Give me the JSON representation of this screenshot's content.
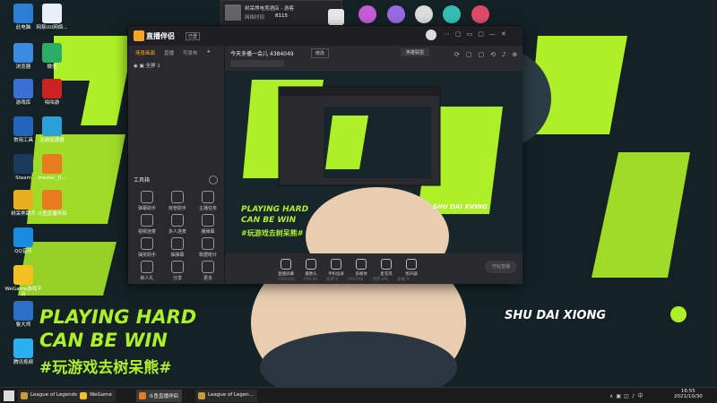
{
  "desktop": {
    "icons": [
      {
        "label": "此电脑",
        "icon": "computer-icon",
        "color": "#2a7fd4"
      },
      {
        "label": "网易UU网络...",
        "icon": "uu-icon",
        "color": "#e8eef5"
      },
      {
        "label": "浏览器",
        "icon": "browser-icon",
        "color": "#3b8be0"
      },
      {
        "label": "微信",
        "icon": "wechat-icon",
        "color": "#2aae67"
      },
      {
        "label": "游戏库",
        "icon": "gamelib-icon",
        "color": "#3b6fd8"
      },
      {
        "label": "咕咕游",
        "icon": "game-icon",
        "color": "#c22"
      },
      {
        "label": "常用工具",
        "icon": "x-icon",
        "color": "#2266bb"
      },
      {
        "label": "迅游加速器",
        "icon": "booster-icon",
        "color": "#2a9fd8"
      },
      {
        "label": "Steam",
        "icon": "steam-icon",
        "color": "#1b3a5c"
      },
      {
        "label": "master_D...",
        "icon": "master-icon",
        "color": "#e87b1f"
      },
      {
        "label": "树呆熊助手",
        "icon": "bear-icon",
        "color": "#e8b020"
      },
      {
        "label": "斗鱼直播伴侣",
        "icon": "douyu-icon",
        "color": "#e87b1f"
      },
      {
        "label": "QQ音乐",
        "icon": "qq-icon",
        "color": "#1a8ce0"
      },
      {
        "label": "WeGame游戏平台",
        "icon": "wegame-icon",
        "color": "#f4c020"
      },
      {
        "label": "鲁大师",
        "icon": "ludashi-icon",
        "color": "#2a6fc8"
      },
      {
        "label": "腾讯视频",
        "icon": "tencentvideo-icon",
        "color": "#2ab0f0"
      }
    ],
    "poster": {
      "line1": "PLAYING HARD",
      "line2": "CAN BE WIN",
      "line3": "#玩游戏去树呆熊#",
      "brand": "SHU DAI XIONG"
    },
    "notify": {
      "title": "树呆熊电竞酒店 - 游客",
      "line1": "网络时间",
      "value": "8115"
    }
  },
  "window": {
    "app_name": "直播伴侣",
    "badge": "已登",
    "room_title": "今天多播一会儿 4384049",
    "room_btn": "修改",
    "category": "英雄联盟",
    "tabs": [
      "场景画面",
      "直播",
      "可发布"
    ],
    "scene": "全屏 1",
    "tools_heading": "工具箱",
    "tools": [
      "弹幕助手",
      "房管助手",
      "主播任务",
      "视频连麦",
      "多人连麦",
      "播弹幕",
      "抽奖助手",
      "抽弹幕",
      "数据统计",
      "新人礼",
      "分享",
      "更多"
    ],
    "bottom": [
      "直播屏幕",
      "摄像头",
      "手机投屏",
      "多媒体",
      "麦克风",
      "扬声器"
    ],
    "start_btn": "开始直播",
    "stats": [
      "CPU:5%",
      "FPS:30",
      "码率:0",
      "CPU:0%",
      "内存:0%",
      "丢帧:0"
    ],
    "room_id": "4384049"
  },
  "taskbar": {
    "items": [
      {
        "label": "League of Legends",
        "color": "#c89b3c"
      },
      {
        "label": "WeGame",
        "color": "#f4c020"
      },
      {
        "label": "斗鱼直播伴侣",
        "color": "#e87b1f"
      },
      {
        "label": "League of Legen...",
        "color": "#c89b3c"
      }
    ],
    "time": "16:55",
    "date": "2021/10/30"
  }
}
